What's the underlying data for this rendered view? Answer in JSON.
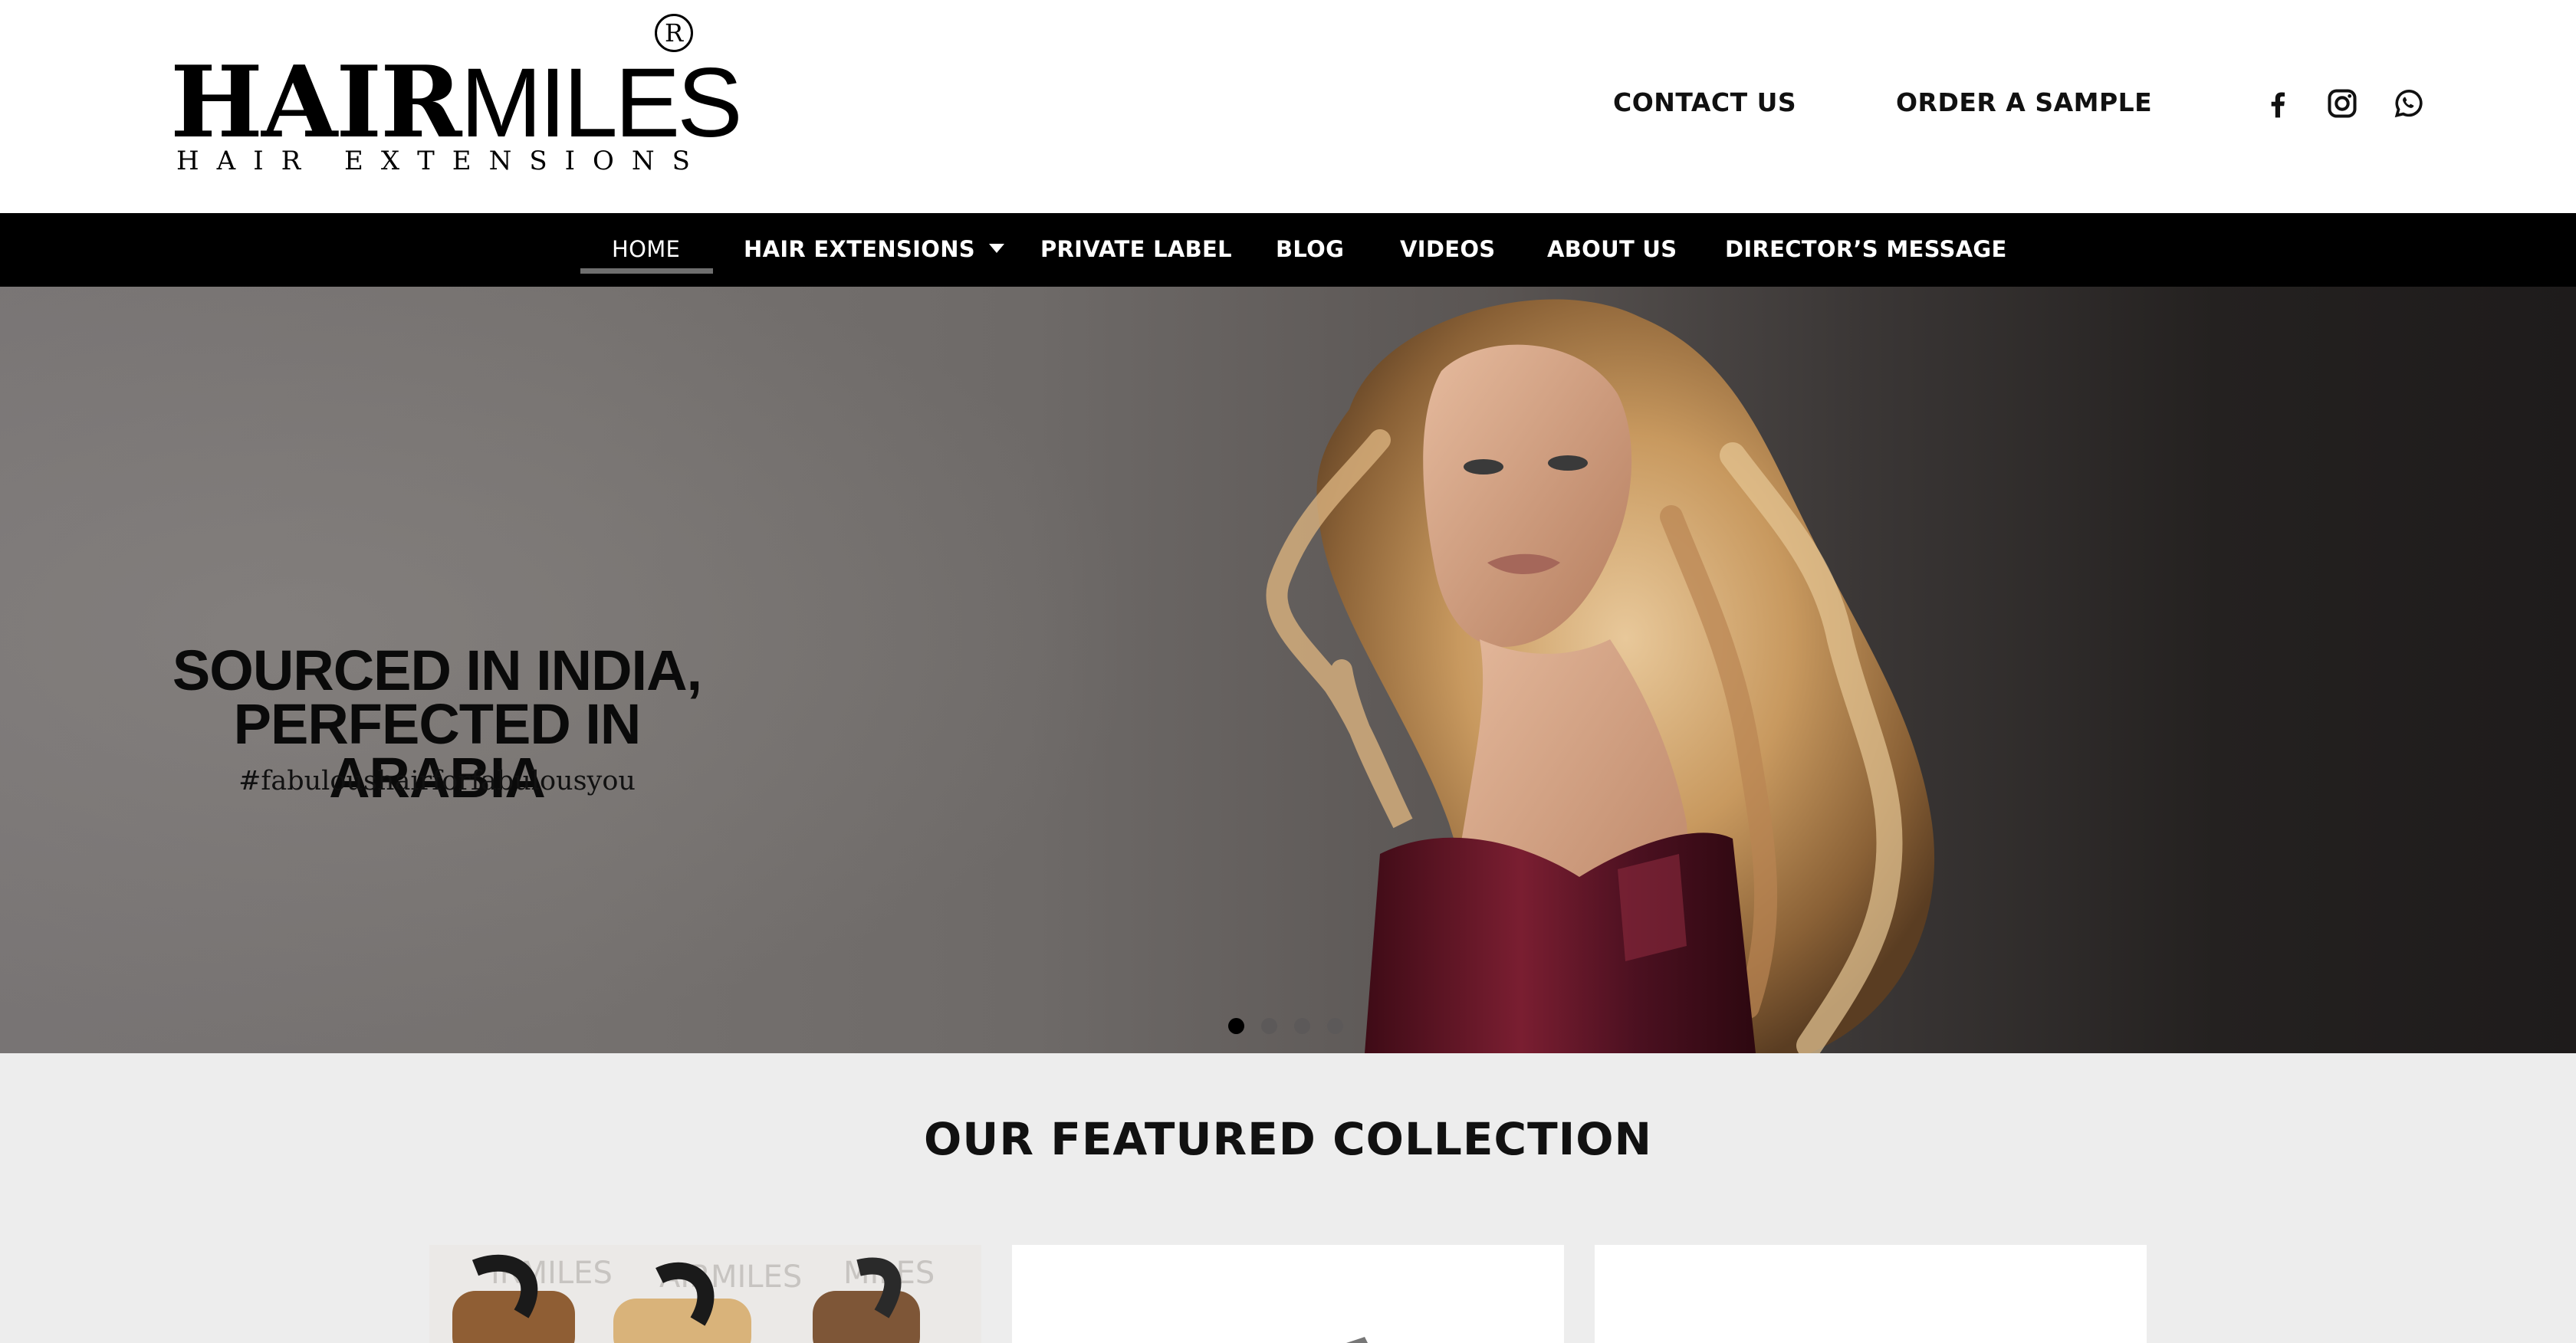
{
  "brand": {
    "name_bold": "HAIR",
    "name_thin": "MILES",
    "tagline": "HAIR EXTENSIONS",
    "registered": "R"
  },
  "header": {
    "contact_label": "CONTACT US",
    "sample_label": "ORDER A SAMPLE",
    "social_icons": [
      "facebook-icon",
      "instagram-icon",
      "whatsapp-icon"
    ]
  },
  "nav": {
    "home": "HOME",
    "hair_extensions": "HAIR EXTENSIONS",
    "private_label": "PRIVATE LABEL",
    "blog": "BLOG",
    "videos": "VIDEOS",
    "about": "ABOUT US",
    "director": "DIRECTOR’S MESSAGE",
    "active": "HOME"
  },
  "hero": {
    "headline_line1": "SOURCED IN INDIA,",
    "headline_line2": "PERFECTED IN ARABIA",
    "hashtag": "#fabuloushairforfabulousyou",
    "slide_count": 4,
    "active_slide": 1
  },
  "featured": {
    "title": "OUR FEATURED COLLECTION",
    "card1_labels": [
      "IRMILES",
      "AIRMILES",
      "MILES"
    ]
  },
  "colors": {
    "nav_bg": "#000000",
    "featured_bg": "#ededed",
    "hair": "#c79a62",
    "dress": "#5b1523"
  }
}
